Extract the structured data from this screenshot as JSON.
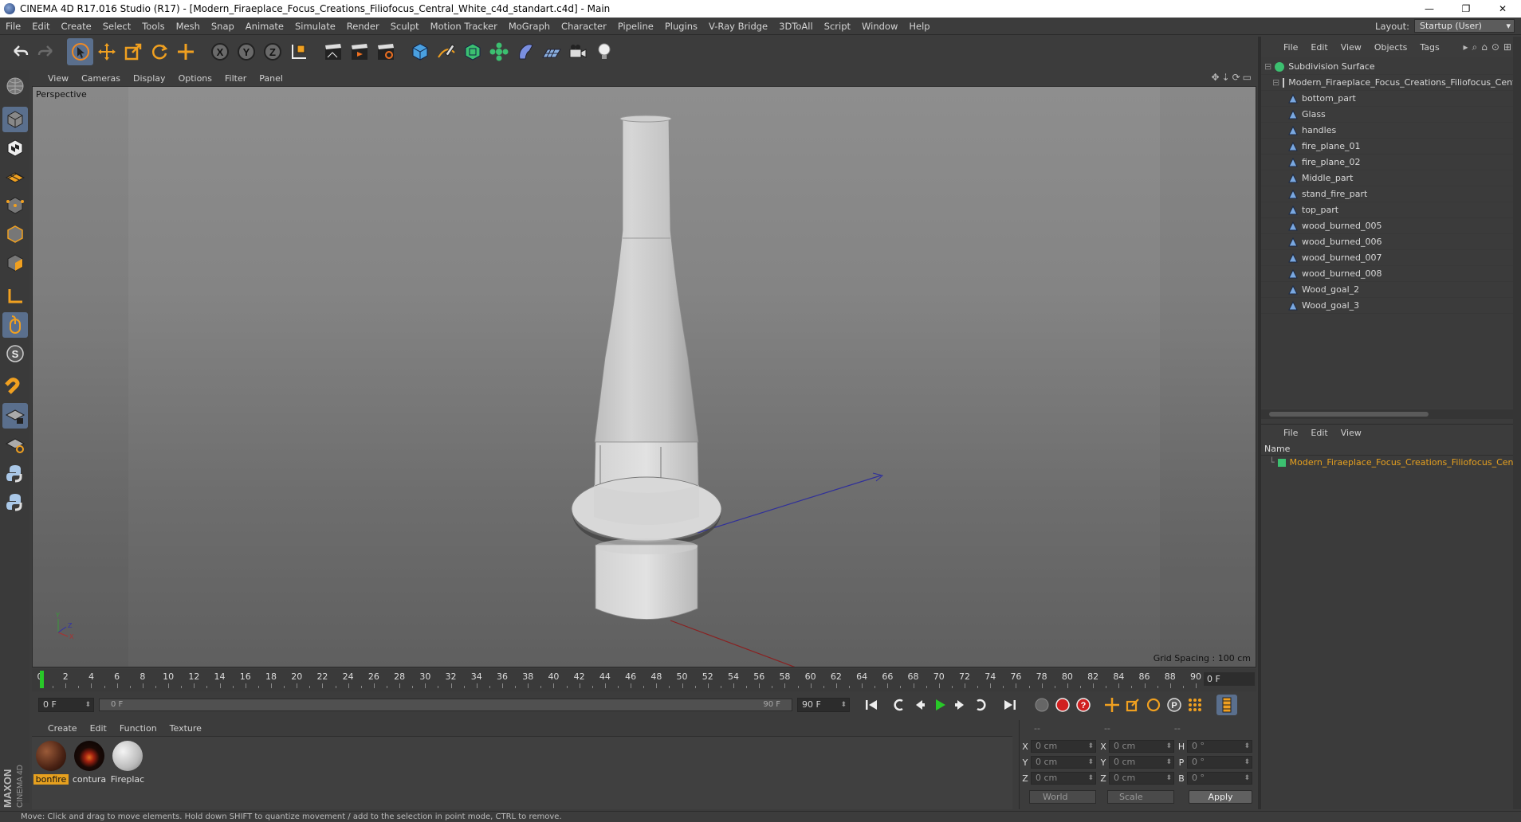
{
  "window": {
    "title": "CINEMA 4D R17.016 Studio (R17) - [Modern_Firaeplace_Focus_Creations_Filiofocus_Central_White_c4d_standart.c4d] - Main",
    "minimize": "—",
    "maximize": "❐",
    "close": "✕"
  },
  "menubar": {
    "items": [
      "File",
      "Edit",
      "Create",
      "Select",
      "Tools",
      "Mesh",
      "Snap",
      "Animate",
      "Simulate",
      "Render",
      "Sculpt",
      "Motion Tracker",
      "MoGraph",
      "Character",
      "Pipeline",
      "Plugins",
      "V-Ray Bridge",
      "3DToAll",
      "Script",
      "Window",
      "Help"
    ],
    "layout_label": "Layout:",
    "layout_value": "Startup (User)"
  },
  "viewport": {
    "menu": [
      "View",
      "Cameras",
      "Display",
      "Options",
      "Filter",
      "Panel"
    ],
    "label": "Perspective",
    "grid_spacing": "Grid Spacing : 100 cm"
  },
  "timeline": {
    "ticks": [
      "0",
      "2",
      "4",
      "6",
      "8",
      "10",
      "12",
      "14",
      "16",
      "18",
      "20",
      "22",
      "24",
      "26",
      "28",
      "30",
      "32",
      "34",
      "36",
      "38",
      "40",
      "42",
      "44",
      "46",
      "48",
      "50",
      "52",
      "54",
      "56",
      "58",
      "60",
      "62",
      "64",
      "66",
      "68",
      "70",
      "72",
      "74",
      "76",
      "78",
      "80",
      "82",
      "84",
      "86",
      "88",
      "90"
    ],
    "current_frame": 0,
    "end_frame_display": "0 F"
  },
  "transport": {
    "start_field": "0 F",
    "range_start": "0 F",
    "range_end": "90 F",
    "end_field": "90 F"
  },
  "materials": {
    "menu": [
      "Create",
      "Edit",
      "Function",
      "Texture"
    ],
    "items": [
      {
        "label": "bonfire",
        "selected": true
      },
      {
        "label": "contura",
        "selected": false
      },
      {
        "label": "Fireplac",
        "selected": false
      }
    ]
  },
  "coordinates": {
    "header": [
      "--",
      "--",
      "--"
    ],
    "rows": [
      {
        "a1": "X",
        "v1": "0 cm",
        "a2": "X",
        "v2": "0 cm",
        "a3": "H",
        "v3": "0 °"
      },
      {
        "a1": "Y",
        "v1": "0 cm",
        "a2": "Y",
        "v2": "0 cm",
        "a3": "P",
        "v3": "0 °"
      },
      {
        "a1": "Z",
        "v1": "0 cm",
        "a2": "Z",
        "v2": "0 cm",
        "a3": "B",
        "v3": "0 °"
      }
    ],
    "world": "World",
    "scale": "Scale",
    "apply": "Apply"
  },
  "objects": {
    "menu": [
      "File",
      "Edit",
      "View",
      "Objects",
      "Tags"
    ],
    "root": "Subdivision Surface",
    "group": "Modern_Firaeplace_Focus_Creations_Filiofocus_Central_White",
    "children": [
      "bottom_part",
      "Glass",
      "handles",
      "fire_plane_01",
      "fire_plane_02",
      "Middle_part",
      "stand_fire_part",
      "top_part",
      "wood_burned_005",
      "wood_burned_006",
      "wood_burned_007",
      "wood_burned_008",
      "Wood_goal_2",
      "Wood_goal_3"
    ]
  },
  "attributes": {
    "menu": [
      "File",
      "Edit",
      "View"
    ],
    "header": "Name",
    "selected_name": "Modern_Firaeplace_Focus_Creations_Filiofocus_Central_White"
  },
  "status": {
    "text": "Move: Click and drag to move elements. Hold down SHIFT to quantize movement / add to the selection in point mode, CTRL to remove."
  },
  "colors": {
    "accent_blue": "#5a6f8d",
    "selection_orange": "#e6a01f",
    "timeline_cursor": "#28c828"
  }
}
